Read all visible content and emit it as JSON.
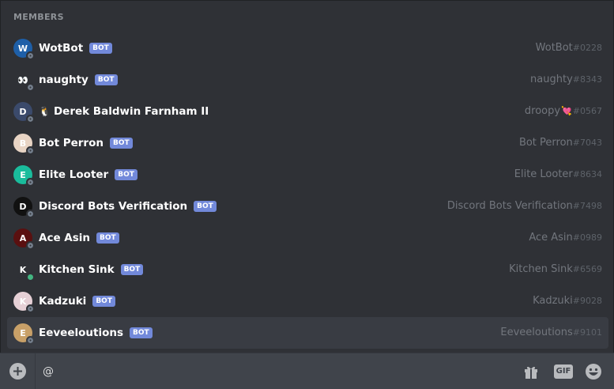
{
  "header": {
    "title": "MEMBERS"
  },
  "members": [
    {
      "name": "WotBot",
      "bot": true,
      "badge": "BOT",
      "username": "WotBot",
      "discriminator": "#0228",
      "status": "offline",
      "avatar_color": "#1e5fa8",
      "avatar_text": "W"
    },
    {
      "name": "naughty",
      "bot": true,
      "badge": "BOT",
      "username": "naughty",
      "discriminator": "#8343",
      "status": "offline",
      "avatar_color": "#2f3136",
      "avatar_text": "👀"
    },
    {
      "name": "Derek Baldwin Farnham II",
      "prefix_emoji": "🐧",
      "bot": false,
      "username": "droopy",
      "username_emoji": "💘",
      "discriminator": "#0567",
      "status": "offline",
      "avatar_color": "#3b4a6b",
      "avatar_text": "D"
    },
    {
      "name": "Bot Perron",
      "bot": true,
      "badge": "BOT",
      "username": "Bot Perron",
      "discriminator": "#7043",
      "status": "offline",
      "avatar_color": "#e8d4c4",
      "avatar_text": "B"
    },
    {
      "name": "Elite Looter",
      "bot": true,
      "badge": "BOT",
      "username": "Elite Looter",
      "discriminator": "#8634",
      "status": "offline",
      "avatar_color": "#1abc9c",
      "avatar_text": "E"
    },
    {
      "name": "Discord Bots Verification",
      "bot": true,
      "badge": "BOT",
      "username": "Discord Bots Verification",
      "discriminator": "#7498",
      "status": "offline",
      "avatar_color": "#111111",
      "avatar_text": "D"
    },
    {
      "name": "Ace Asin",
      "bot": true,
      "badge": "BOT",
      "username": "Ace Asin",
      "discriminator": "#0989",
      "status": "offline",
      "avatar_color": "#5a1010",
      "avatar_text": "A"
    },
    {
      "name": "Kitchen Sink",
      "bot": true,
      "badge": "BOT",
      "username": "Kitchen Sink",
      "discriminator": "#6569",
      "status": "online",
      "avatar_color": "#2f3136",
      "avatar_text": "K"
    },
    {
      "name": "Kadzuki",
      "bot": true,
      "badge": "BOT",
      "username": "Kadzuki",
      "discriminator": "#9028",
      "status": "offline",
      "avatar_color": "#e6d0d6",
      "avatar_text": "K"
    },
    {
      "name": "Eeveeloutions",
      "bot": true,
      "badge": "BOT",
      "username": "Eeveeloutions",
      "discriminator": "#9101",
      "status": "offline",
      "avatar_color": "#c8a068",
      "avatar_text": "E"
    }
  ],
  "composer": {
    "value": "@",
    "gif_label": "GIF"
  },
  "icons": {
    "add": "plus-circle-icon",
    "gift": "gift-icon",
    "gif": "gif-icon",
    "emoji": "emoji-icon"
  }
}
